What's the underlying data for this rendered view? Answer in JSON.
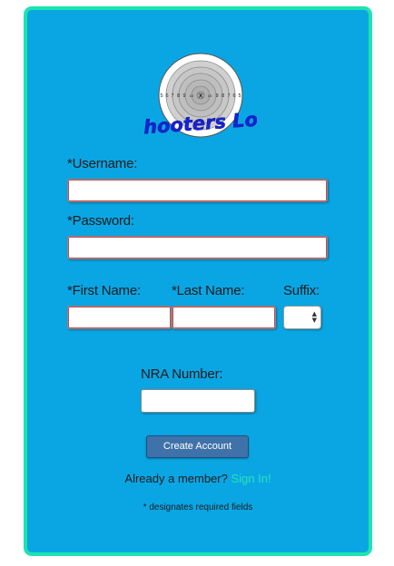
{
  "brand": {
    "title": "Shooters Log",
    "target_numbers_left": [
      "5",
      "6",
      "7",
      "8",
      "9",
      "10"
    ],
    "target_center": "X",
    "target_numbers_right": [
      "10",
      "9",
      "8",
      "7",
      "6",
      "5"
    ]
  },
  "form": {
    "username_label": "*Username:",
    "username_value": "",
    "password_label": "*Password:",
    "password_value": "",
    "first_name_label": "*First Name:",
    "first_name_value": "",
    "last_name_label": "*Last Name:",
    "last_name_value": "",
    "suffix_label": "Suffix:",
    "suffix_value": "",
    "nra_label": "NRA Number:",
    "nra_value": ""
  },
  "actions": {
    "create_account_label": "Create Account",
    "already_member_text": "Already a member?",
    "sign_in_label": "Sign In!"
  },
  "footer": {
    "required_note": "* designates required fields"
  },
  "colors": {
    "card_background": "#0aa6e3",
    "card_border": "#1ee3b0",
    "button": "#3f72a8",
    "link": "#27e3b6",
    "logo_text": "#1522d9"
  }
}
